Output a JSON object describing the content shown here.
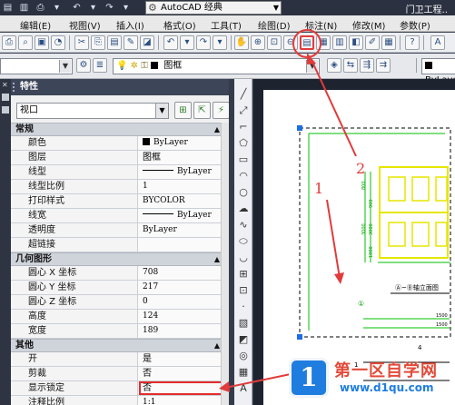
{
  "titlebar": {
    "workspace": "AutoCAD 经典",
    "title": "门卫工程.."
  },
  "menu": [
    "编辑(E)",
    "视图(V)",
    "插入(I)",
    "格式(O)",
    "工具(T)",
    "绘图(D)",
    "标注(N)",
    "修改(M)",
    "参数(P)"
  ],
  "layer_toolbar": {
    "layer_name": "图框",
    "color_value": "ByLaye"
  },
  "palette": {
    "title": "特性",
    "selection": "视口",
    "sections": [
      {
        "name": "常规",
        "rows": [
          {
            "key": "颜色",
            "value": "ByLayer",
            "kind": "swatch"
          },
          {
            "key": "图层",
            "value": "图框",
            "kind": "cn"
          },
          {
            "key": "线型",
            "value": "ByLayer",
            "kind": "line"
          },
          {
            "key": "线型比例",
            "value": "1",
            "kind": "text"
          },
          {
            "key": "打印样式",
            "value": "BYCOLOR",
            "kind": "text"
          },
          {
            "key": "线宽",
            "value": "ByLayer",
            "kind": "line"
          },
          {
            "key": "透明度",
            "value": "ByLayer",
            "kind": "text"
          },
          {
            "key": "超链接",
            "value": "",
            "kind": "text"
          }
        ]
      },
      {
        "name": "几何图形",
        "rows": [
          {
            "key": "圆心 X 坐标",
            "value": "708",
            "kind": "text"
          },
          {
            "key": "圆心 Y 坐标",
            "value": "217",
            "kind": "text"
          },
          {
            "key": "圆心 Z 坐标",
            "value": "0",
            "kind": "text"
          },
          {
            "key": "高度",
            "value": "124",
            "kind": "text"
          },
          {
            "key": "宽度",
            "value": "189",
            "kind": "text"
          }
        ]
      },
      {
        "name": "其他",
        "rows": [
          {
            "key": "开",
            "value": "是",
            "kind": "cn"
          },
          {
            "key": "剪裁",
            "value": "否",
            "kind": "cn"
          },
          {
            "key": "显示锁定",
            "value": "否",
            "kind": "cn",
            "highlight": true
          },
          {
            "key": "注释比例",
            "value": "1:1",
            "kind": "text"
          }
        ]
      }
    ]
  },
  "drawing": {
    "label": "Ⓐ~Ⓑ轴立面图",
    "axis_mark": "①",
    "dims": [
      "1500",
      "1500",
      "800",
      "3000",
      "900",
      "1800",
      "3000",
      "4",
      "1"
    ]
  },
  "annotations": [
    "1",
    "2"
  ],
  "watermark": {
    "logo": "1",
    "name": "第一区自学网",
    "url": "www.d1qu.com"
  },
  "colors": {
    "highlight": "#e23b3b",
    "palette_header": "#3d4658",
    "model_bg": "#1d232f",
    "yellow": "#ffff00",
    "green": "#00c000"
  }
}
